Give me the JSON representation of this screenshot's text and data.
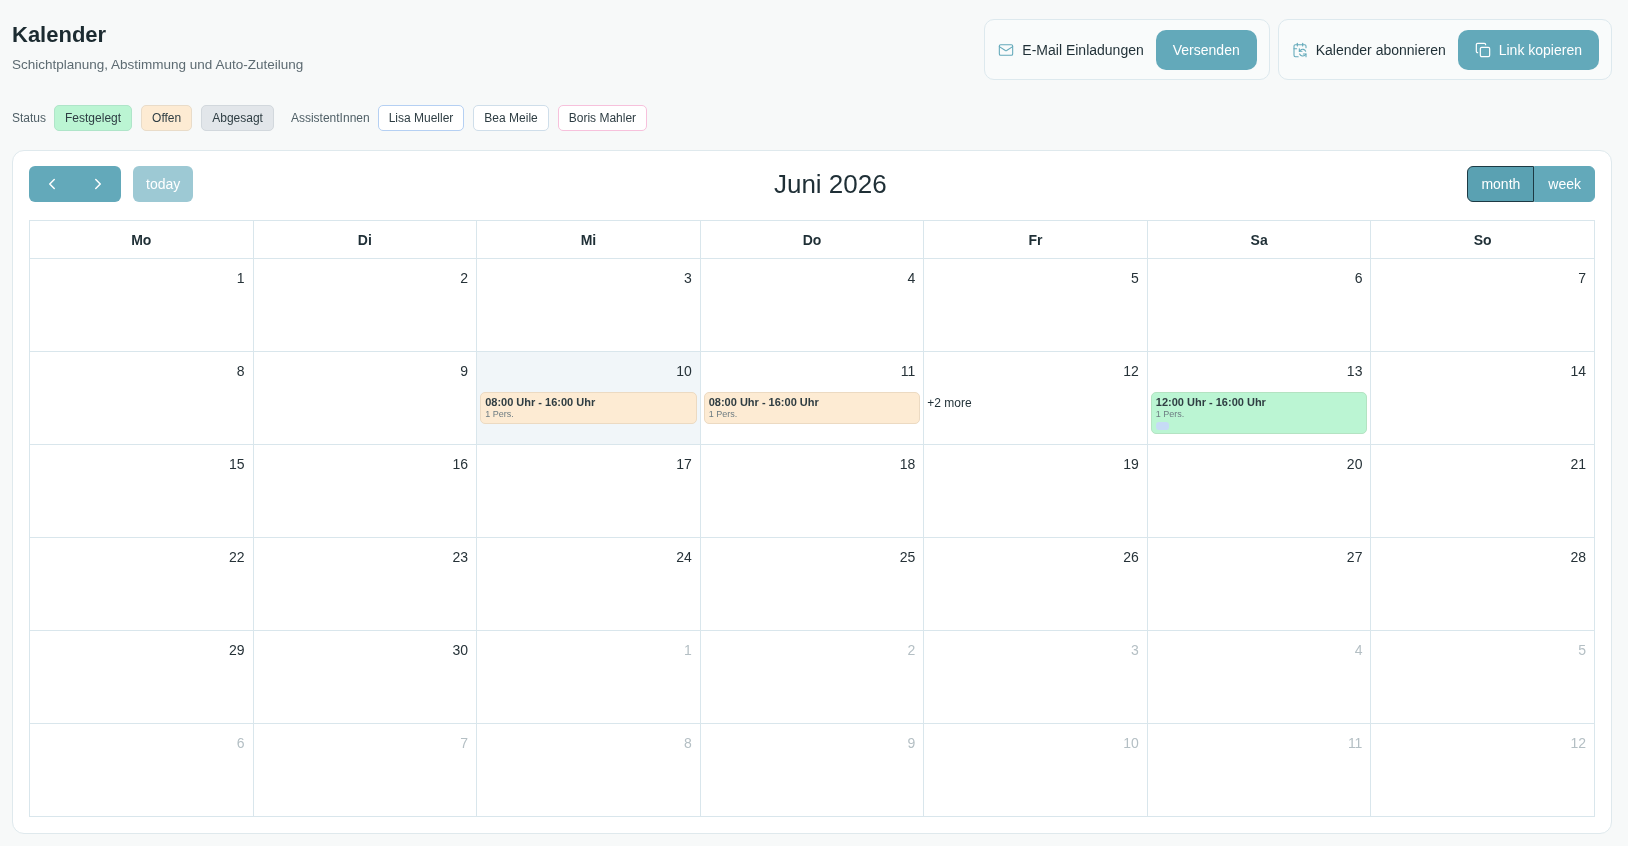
{
  "header": {
    "title": "Kalender",
    "subtitle": "Schichtplanung, Abstimmung und Auto-Zuteilung"
  },
  "actions": [
    {
      "kind": "email",
      "label": "E-Mail Einladungen",
      "button": "Versenden"
    },
    {
      "kind": "subscribe",
      "label": "Kalender abonnieren",
      "button": "Link kopieren"
    }
  ],
  "legend": {
    "status_label": "Status",
    "statuses": [
      {
        "label": "Festgelegt",
        "color": "#bbf5d3"
      },
      {
        "label": "Offen",
        "color": "#fdebd3"
      },
      {
        "label": "Abgesagt",
        "color": "#e2e6ea"
      }
    ],
    "assistants_label": "AssistentInnen",
    "assistants": [
      {
        "name": "Lisa Mueller",
        "color": "#b5d0f3"
      },
      {
        "name": "Bea Meile",
        "color": "#cfdeea"
      },
      {
        "name": "Boris Mahler",
        "color": "#f7c1dc"
      }
    ]
  },
  "calendar": {
    "title": "Juni 2026",
    "today_button": {
      "label": "today",
      "disabled": true
    },
    "views": [
      {
        "label": "month",
        "selected": true
      },
      {
        "label": "week",
        "selected": false
      }
    ],
    "weekdays": [
      "Mo",
      "Di",
      "Mi",
      "Do",
      "Fr",
      "Sa",
      "So"
    ],
    "weeks": [
      {
        "days": [
          {
            "day": "1",
            "outside": false,
            "today": false
          },
          {
            "day": "2",
            "outside": false,
            "today": false
          },
          {
            "day": "3",
            "outside": false,
            "today": false
          },
          {
            "day": "4",
            "outside": false,
            "today": false
          },
          {
            "day": "5",
            "outside": false,
            "today": false
          },
          {
            "day": "6",
            "outside": false,
            "today": false
          },
          {
            "day": "7",
            "outside": false,
            "today": false
          }
        ]
      },
      {
        "days": [
          {
            "day": "8",
            "outside": false,
            "today": false
          },
          {
            "day": "9",
            "outside": false,
            "today": false
          },
          {
            "day": "10",
            "outside": false,
            "today": true,
            "events": [
              {
                "time": "08:00 Uhr - 16:00 Uhr",
                "persons": "1 Pers.",
                "color": "#fdebd3"
              }
            ]
          },
          {
            "day": "11",
            "outside": false,
            "today": false,
            "events": [
              {
                "time": "08:00 Uhr - 16:00 Uhr",
                "persons": "1 Pers.",
                "color": "#fdebd3"
              }
            ]
          },
          {
            "day": "12",
            "outside": false,
            "today": false,
            "more": "+2 more"
          },
          {
            "day": "13",
            "outside": false,
            "today": false,
            "events": [
              {
                "time": "12:00 Uhr - 16:00 Uhr",
                "persons": "1 Pers.",
                "color": "#bbf5d3",
                "markers": [
                  {
                    "color": "#c6dbf5"
                  }
                ]
              }
            ]
          },
          {
            "day": "14",
            "outside": false,
            "today": false
          }
        ]
      },
      {
        "days": [
          {
            "day": "15",
            "outside": false,
            "today": false
          },
          {
            "day": "16",
            "outside": false,
            "today": false
          },
          {
            "day": "17",
            "outside": false,
            "today": false
          },
          {
            "day": "18",
            "outside": false,
            "today": false
          },
          {
            "day": "19",
            "outside": false,
            "today": false
          },
          {
            "day": "20",
            "outside": false,
            "today": false
          },
          {
            "day": "21",
            "outside": false,
            "today": false
          }
        ]
      },
      {
        "days": [
          {
            "day": "22",
            "outside": false,
            "today": false
          },
          {
            "day": "23",
            "outside": false,
            "today": false
          },
          {
            "day": "24",
            "outside": false,
            "today": false
          },
          {
            "day": "25",
            "outside": false,
            "today": false
          },
          {
            "day": "26",
            "outside": false,
            "today": false
          },
          {
            "day": "27",
            "outside": false,
            "today": false
          },
          {
            "day": "28",
            "outside": false,
            "today": false
          }
        ]
      },
      {
        "days": [
          {
            "day": "29",
            "outside": false,
            "today": false
          },
          {
            "day": "30",
            "outside": false,
            "today": false
          },
          {
            "day": "1",
            "outside": true,
            "today": false
          },
          {
            "day": "2",
            "outside": true,
            "today": false
          },
          {
            "day": "3",
            "outside": true,
            "today": false
          },
          {
            "day": "4",
            "outside": true,
            "today": false
          },
          {
            "day": "5",
            "outside": true,
            "today": false
          }
        ]
      },
      {
        "days": [
          {
            "day": "6",
            "outside": true,
            "today": false
          },
          {
            "day": "7",
            "outside": true,
            "today": false
          },
          {
            "day": "8",
            "outside": true,
            "today": false
          },
          {
            "day": "9",
            "outside": true,
            "today": false
          },
          {
            "day": "10",
            "outside": true,
            "today": false
          },
          {
            "day": "11",
            "outside": true,
            "today": false
          },
          {
            "day": "12",
            "outside": true,
            "today": false
          }
        ]
      }
    ]
  }
}
